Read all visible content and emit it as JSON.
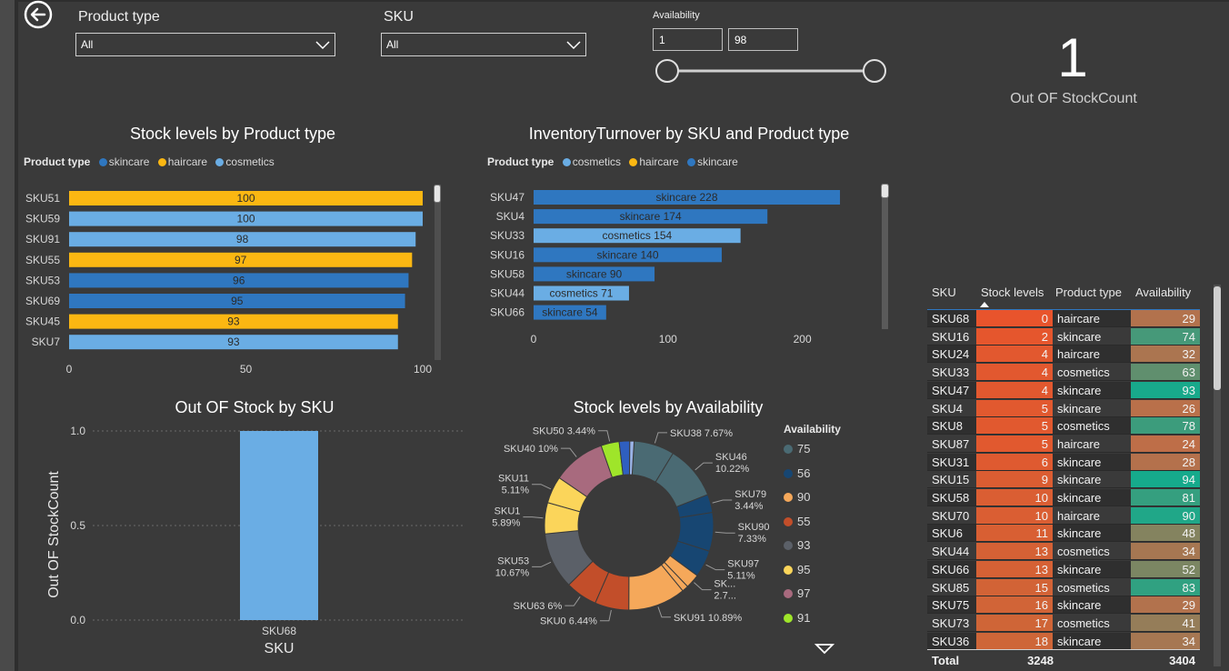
{
  "slicers": {
    "product_type": {
      "label": "Product type",
      "value": "All"
    },
    "sku": {
      "label": "SKU",
      "value": "All"
    },
    "availability": {
      "label": "Availability",
      "min": "1",
      "max": "98",
      "slider_low": 1,
      "slider_high": 98
    }
  },
  "card": {
    "value": "1",
    "label": "Out OF StockCount"
  },
  "colors": {
    "skincare": "#2f77c0",
    "haircare": "#fbb712",
    "cosmetics": "#6aade4"
  },
  "chart_data": [
    {
      "id": "stock-by-product-type",
      "type": "bar",
      "orientation": "horizontal",
      "title": "Stock levels by Product type",
      "legend": {
        "title": "Product type",
        "entries": [
          "skincare",
          "haircare",
          "cosmetics"
        ],
        "position": "top-left"
      },
      "categories": [
        "SKU51",
        "SKU59",
        "SKU91",
        "SKU55",
        "SKU53",
        "SKU69",
        "SKU45",
        "SKU7"
      ],
      "values": [
        100,
        100,
        98,
        97,
        96,
        95,
        93,
        93
      ],
      "groups": [
        "haircare",
        "cosmetics",
        "cosmetics",
        "haircare",
        "skincare",
        "skincare",
        "haircare",
        "cosmetics"
      ],
      "xlim": [
        0,
        100
      ],
      "xticks": [
        0,
        50,
        100
      ]
    },
    {
      "id": "turnover-by-sku",
      "type": "bar",
      "orientation": "horizontal",
      "title": "InventoryTurnover by SKU and Product type",
      "legend": {
        "title": "Product type",
        "entries": [
          "cosmetics",
          "haircare",
          "skincare"
        ],
        "position": "top-left"
      },
      "categories": [
        "SKU47",
        "SKU4",
        "SKU33",
        "SKU16",
        "SKU58",
        "SKU44",
        "SKU66"
      ],
      "values": [
        228,
        174,
        154,
        140,
        90,
        71,
        54
      ],
      "groups": [
        "skincare",
        "skincare",
        "cosmetics",
        "skincare",
        "skincare",
        "cosmetics",
        "skincare"
      ],
      "xlim": [
        0,
        230
      ],
      "xticks": [
        0,
        100,
        200
      ]
    },
    {
      "id": "out-of-stock-by-sku",
      "type": "bar",
      "title": "Out OF Stock by SKU",
      "xlabel": "SKU",
      "ylabel": "Out OF StockCount",
      "categories": [
        "SKU68"
      ],
      "values": [
        1
      ],
      "ylim": [
        0,
        1
      ],
      "yticks": [
        "0.0",
        "0.5",
        "1.0"
      ]
    },
    {
      "id": "stock-by-availability",
      "type": "pie",
      "donut": true,
      "title": "Stock levels by Availability",
      "legend": {
        "title": "Availability",
        "entries": [
          "75",
          "56",
          "90",
          "55",
          "93",
          "95",
          "97",
          "91"
        ],
        "colors": [
          "#4a6a73",
          "#174672",
          "#f5a85a",
          "#c24e2a",
          "#5b6068",
          "#fbd55a",
          "#a86a7e",
          "#9fe52a"
        ],
        "position": "right"
      },
      "slices": [
        {
          "label": "SKU38 7.67%",
          "value": 7.67,
          "color": "#4a6a73"
        },
        {
          "label": "SKU46 10.22%",
          "value": 10.22,
          "color": "#4a6a73"
        },
        {
          "label": "SKU79 3.44%",
          "value": 3.44,
          "color": "#174672"
        },
        {
          "label": "SKU90 7.33%",
          "value": 7.33,
          "color": "#174672"
        },
        {
          "label": "SKU97 5.11%",
          "value": 5.11,
          "color": "#174672"
        },
        {
          "label": "SK... 2.7...",
          "value": 2.7,
          "color": "#f5a85a"
        },
        {
          "label": "",
          "value": 1.2,
          "color": "#f5a85a"
        },
        {
          "label": "SKU91 10.89%",
          "value": 10.89,
          "color": "#f5a85a"
        },
        {
          "label": "SKU0 6.44%",
          "value": 6.44,
          "color": "#c24e2a"
        },
        {
          "label": "SKU63 6%",
          "value": 6,
          "color": "#c24e2a"
        },
        {
          "label": "SKU53 10.67%",
          "value": 10.67,
          "color": "#5b6068"
        },
        {
          "label": "SKU1 5.89%",
          "value": 5.89,
          "color": "#fbd55a"
        },
        {
          "label": "SKU11 5.11%",
          "value": 5.11,
          "color": "#fbd55a"
        },
        {
          "label": "SKU40 10%",
          "value": 10,
          "color": "#a86a7e"
        },
        {
          "label": "SKU50 3.44%",
          "value": 3.44,
          "color": "#9fe52a"
        },
        {
          "label": "",
          "value": 2.0,
          "color": "#2f5fbf"
        },
        {
          "label": "",
          "value": 0.8,
          "color": "#9ab4e8"
        }
      ]
    }
  ],
  "table": {
    "columns": [
      "SKU",
      "Stock levels",
      "Product type",
      "Availability"
    ],
    "rows": [
      [
        "SKU68",
        0,
        "haircare",
        29
      ],
      [
        "SKU16",
        2,
        "skincare",
        74
      ],
      [
        "SKU24",
        4,
        "haircare",
        32
      ],
      [
        "SKU33",
        4,
        "cosmetics",
        63
      ],
      [
        "SKU47",
        4,
        "skincare",
        93
      ],
      [
        "SKU4",
        5,
        "skincare",
        26
      ],
      [
        "SKU8",
        5,
        "cosmetics",
        78
      ],
      [
        "SKU87",
        5,
        "haircare",
        24
      ],
      [
        "SKU31",
        6,
        "skincare",
        28
      ],
      [
        "SKU15",
        9,
        "skincare",
        94
      ],
      [
        "SKU58",
        10,
        "skincare",
        81
      ],
      [
        "SKU70",
        10,
        "haircare",
        90
      ],
      [
        "SKU6",
        11,
        "skincare",
        48
      ],
      [
        "SKU44",
        13,
        "cosmetics",
        34
      ],
      [
        "SKU66",
        13,
        "skincare",
        52
      ],
      [
        "SKU85",
        15,
        "cosmetics",
        83
      ],
      [
        "SKU75",
        16,
        "skincare",
        29
      ],
      [
        "SKU73",
        17,
        "cosmetics",
        41
      ],
      [
        "SKU36",
        18,
        "skincare",
        34
      ]
    ],
    "total": {
      "label": "Total",
      "stock": "3248",
      "availability": "3404"
    }
  }
}
